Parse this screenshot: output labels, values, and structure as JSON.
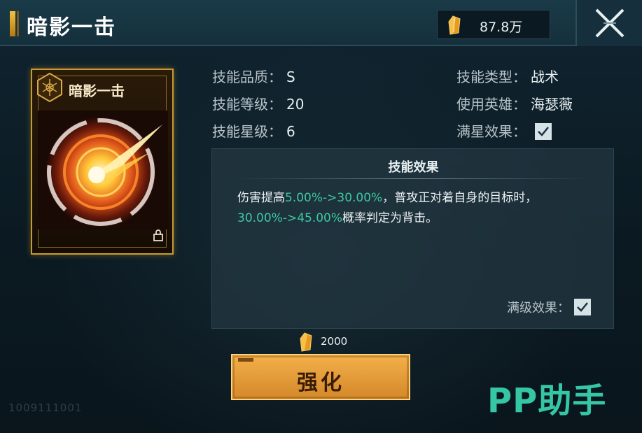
{
  "header": {
    "title": "暗影一击",
    "currency_amount": "87.8万",
    "currency_icon": "gold-crystal-icon",
    "close_icon": "close-icon"
  },
  "card": {
    "name": "暗影一击",
    "emblem_icon": "hexagon-emblem-icon",
    "art": "golden-burst-ring",
    "lock_icon": "lock-icon"
  },
  "info": {
    "quality_label": "技能品质：",
    "quality_value": "S",
    "level_label": "技能等级：",
    "level_value": "20",
    "star_label": "技能星级：",
    "star_value": "6",
    "type_label": "技能类型：",
    "type_value": "战术",
    "hero_label": "使用英雄：",
    "hero_value": "海瑟薇",
    "max_star_label": "满星效果：",
    "max_star_checked": true
  },
  "effect": {
    "title": "技能效果",
    "text_1": "伤害提高",
    "hl_1": "5.00%->30.00%",
    "text_2": "，普攻正对着自身的目标时，",
    "hl_2": "30.00%->45.00%",
    "text_3": "概率判定为背击。",
    "max_level_label": "满级效果：",
    "max_level_checked": true
  },
  "upgrade": {
    "cost": "2000",
    "button_label": "强化"
  },
  "footer": {
    "serial": "1009111001",
    "watermark": "PP助手"
  },
  "colors": {
    "accent_gold": "#f3b04a",
    "highlight_green": "#3fc7a0",
    "background": "#0d1c24"
  }
}
